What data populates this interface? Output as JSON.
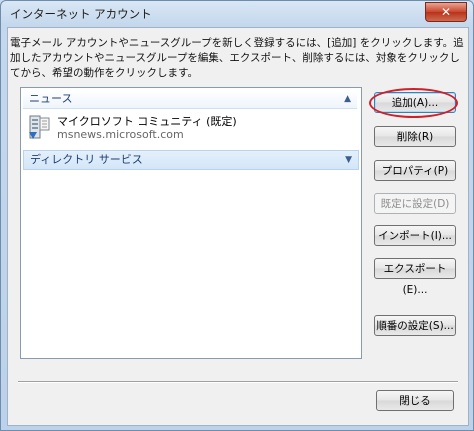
{
  "window": {
    "title": "インターネット アカウント",
    "close_glyph": "✕"
  },
  "description": "電子メール アカウントやニュースグループを新しく登録するには、[追加] をクリックします。追加したアカウントやニュースグループを編集、エクスポート、削除するには、対象をクリックしてから、希望の動作をクリックします。",
  "list": {
    "groups": [
      {
        "label": "ニュース",
        "expanded": true,
        "items": [
          {
            "name": "マイクロソフト コミュニティ (既定)",
            "server": "msnews.microsoft.com",
            "icon": "news-server-icon"
          }
        ]
      },
      {
        "label": "ディレクトリ サービス",
        "expanded": false,
        "items": []
      }
    ]
  },
  "buttons": {
    "add": "追加(A)...",
    "remove": "削除(R)",
    "properties": "プロパティ(P)",
    "set_default": "既定に設定(D)",
    "import": "インポート(I)...",
    "export": "エクスポート(E)...",
    "order": "順番の設定(S)...",
    "close": "閉じる"
  },
  "colors": {
    "highlight_circle": "#d0202a",
    "group_header_text": "#1e3f72"
  }
}
